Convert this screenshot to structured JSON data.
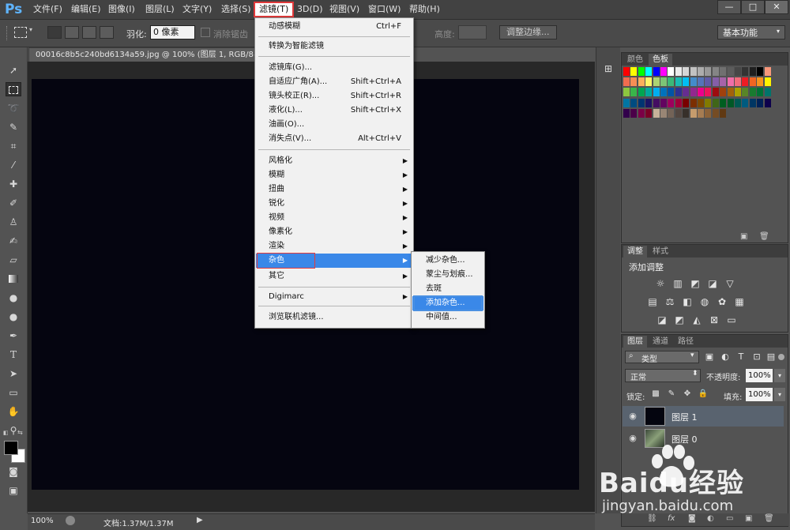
{
  "app": {
    "logo": "Ps"
  },
  "menubar": {
    "items": [
      "文件(F)",
      "编辑(E)",
      "图像(I)",
      "图层(L)",
      "文字(Y)",
      "选择(S)",
      "滤镜(T)",
      "3D(D)",
      "视图(V)",
      "窗口(W)",
      "帮助(H)"
    ],
    "active_index": 6
  },
  "window_controls": {
    "minimize": "—",
    "maximize": "□",
    "close": "✕"
  },
  "options_bar": {
    "feather_label": "羽化:",
    "feather_value": "0 像素",
    "antialias_label": "消除锯齿",
    "height_label": "高度:",
    "refine_edge_button": "调整边缘...",
    "workspace": "基本功能"
  },
  "document": {
    "tab_title": "00016c8b5c240bd6134a59.jpg @ 100% (图层 1, RGB/8#) *",
    "zoom": "100%",
    "doc_size": "文档:1.37M/1.37M"
  },
  "colors": {
    "foreground": "#000000",
    "background": "#ffffff",
    "canvas": "#050510",
    "menu_highlight": "#3a88e8",
    "annotation_red": "#e53b3b"
  },
  "filter_menu": {
    "items": [
      {
        "label": "动感模糊",
        "shortcut": "Ctrl+F"
      },
      {
        "label": "转换为智能滤镜"
      },
      {
        "label": "滤镜库(G)..."
      },
      {
        "label": "自适应广角(A)...",
        "shortcut": "Shift+Ctrl+A"
      },
      {
        "label": "镜头校正(R)...",
        "shortcut": "Shift+Ctrl+R"
      },
      {
        "label": "液化(L)...",
        "shortcut": "Shift+Ctrl+X"
      },
      {
        "label": "油画(O)..."
      },
      {
        "label": "消失点(V)...",
        "shortcut": "Alt+Ctrl+V"
      },
      {
        "label": "风格化",
        "submenu": true
      },
      {
        "label": "模糊",
        "submenu": true
      },
      {
        "label": "扭曲",
        "submenu": true
      },
      {
        "label": "锐化",
        "submenu": true
      },
      {
        "label": "视频",
        "submenu": true
      },
      {
        "label": "像素化",
        "submenu": true
      },
      {
        "label": "渲染",
        "submenu": true
      },
      {
        "label": "杂色",
        "submenu": true,
        "highlighted": true
      },
      {
        "label": "其它",
        "submenu": true
      },
      {
        "label": "Digimarc",
        "submenu": true
      },
      {
        "label": "浏览联机滤镜..."
      }
    ]
  },
  "noise_submenu": {
    "items": [
      "减少杂色...",
      "蒙尘与划痕...",
      "去斑",
      "添加杂色...",
      "中间值..."
    ],
    "highlighted_index": 3
  },
  "panels": {
    "swatches": {
      "tabs": [
        "颜色",
        "色板"
      ],
      "active_tab": 1
    },
    "adjustments": {
      "tabs": [
        "调整",
        "样式"
      ],
      "active_tab": 0,
      "title": "添加调整"
    },
    "layers": {
      "tabs": [
        "图层",
        "通道",
        "路径"
      ],
      "active_tab": 0,
      "filter_kind": "类型",
      "blend_mode": "正常",
      "opacity_label": "不透明度:",
      "opacity_value": "100%",
      "lock_label": "锁定:",
      "fill_label": "填充:",
      "fill_value": "100%",
      "layers": [
        {
          "name": "图层 1",
          "selected": true
        },
        {
          "name": "图层 0",
          "selected": false
        }
      ]
    }
  },
  "watermark": {
    "brand": "Baidu经验",
    "url": "jingyan.baidu.com"
  }
}
